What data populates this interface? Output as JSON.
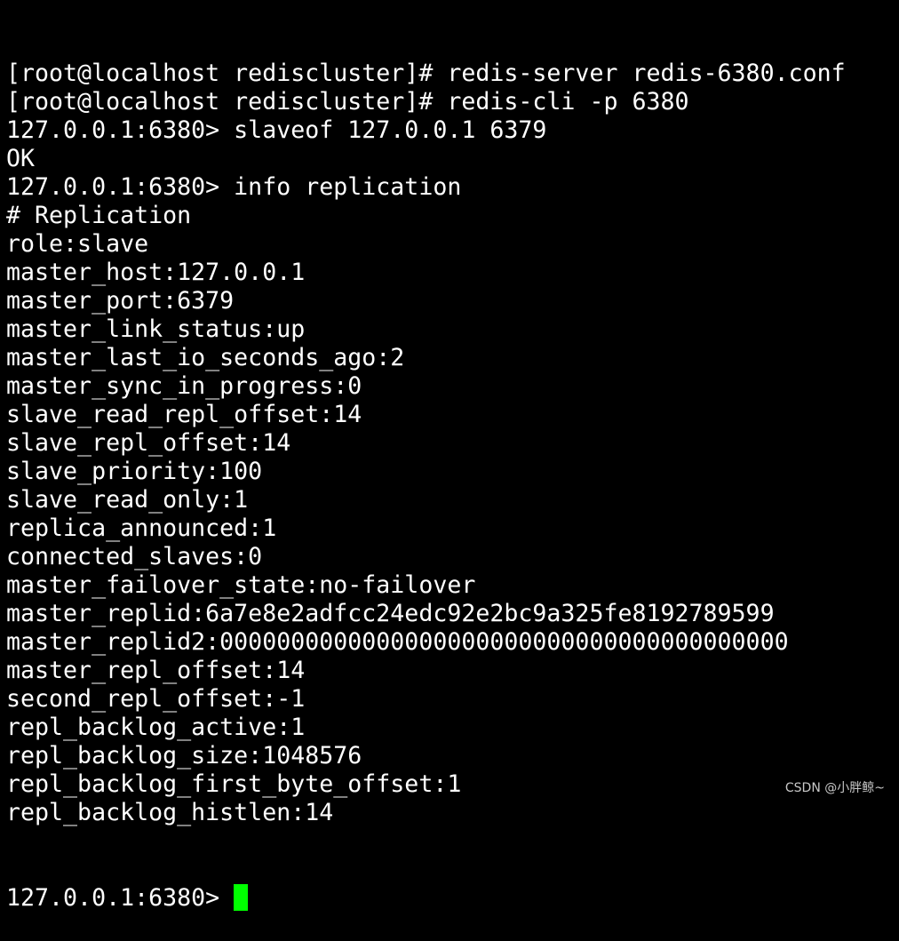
{
  "lines": [
    "[root@localhost rediscluster]# redis-server redis-6380.conf",
    "[root@localhost rediscluster]# redis-cli -p 6380",
    "127.0.0.1:6380> slaveof 127.0.0.1 6379",
    "OK",
    "127.0.0.1:6380> info replication",
    "# Replication",
    "role:slave",
    "master_host:127.0.0.1",
    "master_port:6379",
    "master_link_status:up",
    "master_last_io_seconds_ago:2",
    "master_sync_in_progress:0",
    "slave_read_repl_offset:14",
    "slave_repl_offset:14",
    "slave_priority:100",
    "slave_read_only:1",
    "replica_announced:1",
    "connected_slaves:0",
    "master_failover_state:no-failover",
    "master_replid:6a7e8e2adfcc24edc92e2bc9a325fe8192789599",
    "master_replid2:0000000000000000000000000000000000000000",
    "master_repl_offset:14",
    "second_repl_offset:-1",
    "repl_backlog_active:1",
    "repl_backlog_size:1048576",
    "repl_backlog_first_byte_offset:1",
    "repl_backlog_histlen:14"
  ],
  "prompt": "127.0.0.1:6380> ",
  "watermark": "CSDN @小胖鲸~",
  "colors": {
    "cursor": "#00ff00",
    "text": "#ffffff",
    "background": "#000000"
  }
}
